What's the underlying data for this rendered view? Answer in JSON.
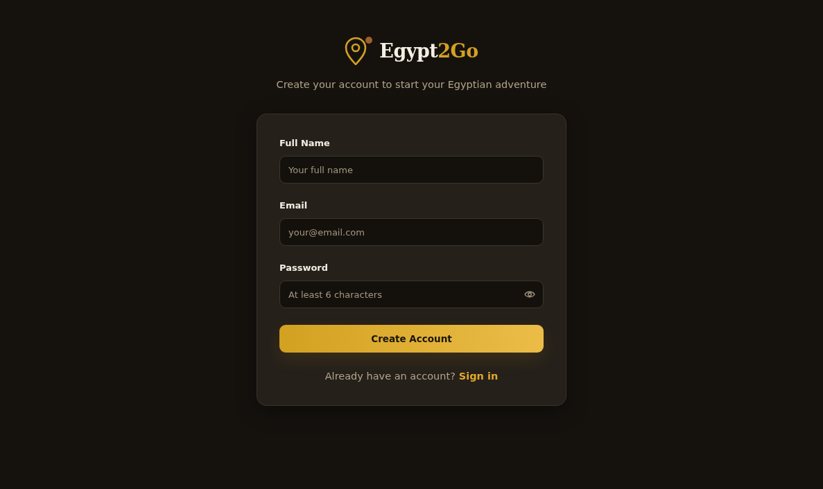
{
  "brand": {
    "name": "Egypt",
    "accent": "2Go"
  },
  "subtitle": "Create your account to start your Egyptian adventure",
  "fields": [
    {
      "label": "Full Name",
      "placeholder": "Your full name",
      "kind": "text"
    },
    {
      "label": "Email",
      "placeholder": "your@email.com",
      "kind": "email"
    },
    {
      "label": "Password",
      "placeholder": "At least 6 characters",
      "kind": "password"
    }
  ],
  "submit": "Create Account",
  "footer": {
    "text": "Already have an account?",
    "link": "Sign in"
  }
}
